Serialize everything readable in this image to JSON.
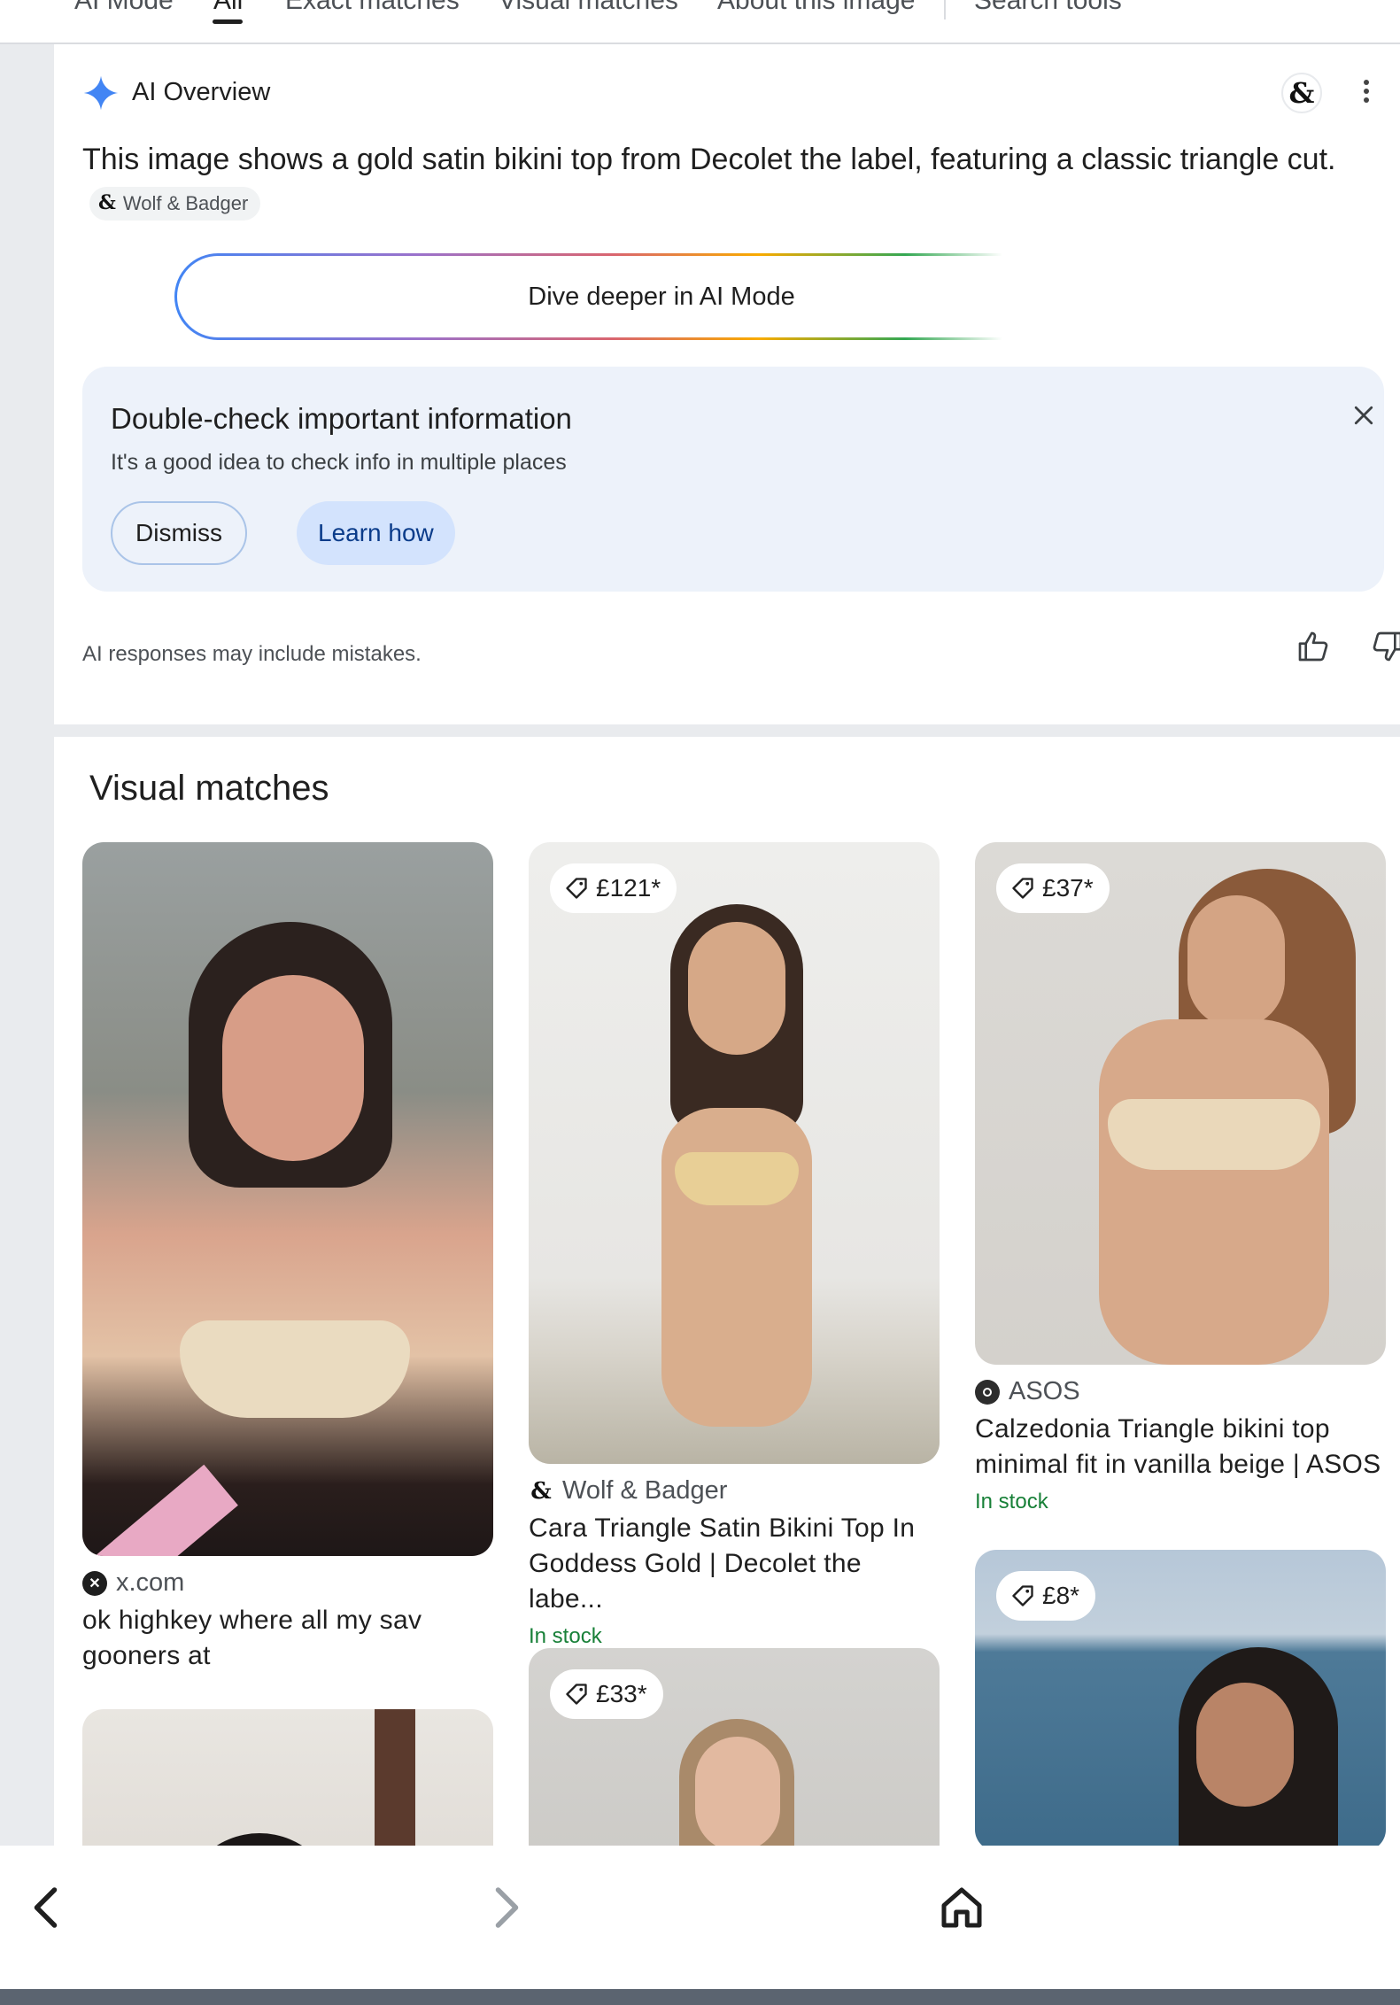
{
  "tabs": {
    "items": [
      {
        "label": "AI Mode",
        "active": false
      },
      {
        "label": "All",
        "active": true
      },
      {
        "label": "Exact matches",
        "active": false
      },
      {
        "label": "Visual matches",
        "active": false
      },
      {
        "label": "About this image",
        "active": false
      },
      {
        "label": "Search tools",
        "active": false
      }
    ]
  },
  "ai_overview": {
    "title": "AI Overview",
    "summary": "This image shows a gold satin bikini top from Decolet the label, featuring a classic triangle cut.",
    "source_chip": "Wolf & Badger",
    "source_avatar_glyph": "&",
    "dive_button": "Dive deeper in AI Mode",
    "notice": {
      "title": "Double-check important information",
      "subtitle": "It's a good idea to check info in multiple places",
      "dismiss": "Dismiss",
      "learn": "Learn how"
    },
    "disclaimer": "AI responses may include mistakes."
  },
  "visual_matches": {
    "heading": "Visual matches",
    "cards": [
      {
        "source": "x.com",
        "title": "ok highkey where all my sav gooners at",
        "price": "",
        "stock": "",
        "icon": "x-logo-icon"
      },
      {
        "source": "Wolf & Badger",
        "title": "Cara Triangle Satin Bikini Top In Goddess Gold | Decolet the labe...",
        "price": "£121*",
        "stock": "In stock",
        "icon": "wolf-badger-icon"
      },
      {
        "source": "ASOS",
        "title": "Calzedonia Triangle bikini top minimal fit in vanilla beige | ASOS",
        "price": "£37*",
        "stock": "In stock",
        "icon": "asos-icon"
      },
      {
        "source": "",
        "title": "",
        "price": "",
        "stock": "",
        "icon": ""
      },
      {
        "source": "",
        "title": "",
        "price": "£33*",
        "stock": "",
        "icon": ""
      },
      {
        "source": "",
        "title": "",
        "price": "£8*",
        "stock": "",
        "icon": ""
      }
    ]
  },
  "colors": {
    "in_stock": "#188038",
    "notice_bg": "#edf2fa",
    "learn_bg": "#d3e3fd",
    "spark": "#4285f4"
  },
  "bottom_nav": {
    "back": "chevron-left-icon",
    "forward": "chevron-right-icon",
    "home": "home-icon"
  }
}
